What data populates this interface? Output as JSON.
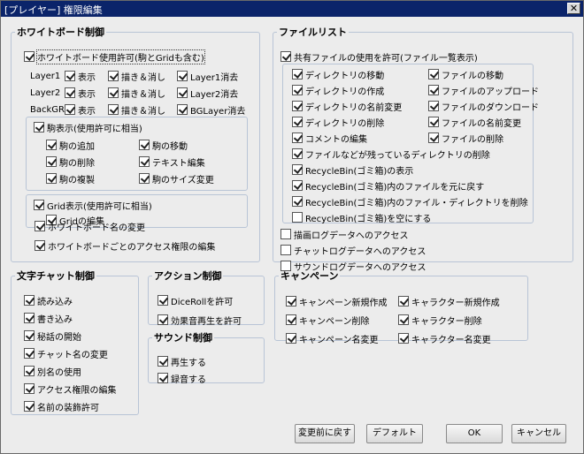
{
  "window": {
    "title": "[プレイヤー] 権限編集",
    "close_symbol": "✕"
  },
  "whiteboard": {
    "legend": "ホワイトボード制御",
    "allow": {
      "label": "ホワイトボード使用許可(駒とGridも含む)",
      "checked": true
    },
    "layers": [
      {
        "name": "Layer1",
        "show": "表示",
        "draw": "描き＆消し",
        "clear": "Layer1消去",
        "show_checked": true,
        "draw_checked": true,
        "clear_checked": true
      },
      {
        "name": "Layer2",
        "show": "表示",
        "draw": "描き＆消し",
        "clear": "Layer2消去",
        "show_checked": true,
        "draw_checked": true,
        "clear_checked": true
      },
      {
        "name": "BackGR",
        "show": "表示",
        "draw": "描き＆消し",
        "clear": "BGLayer消去",
        "show_checked": true,
        "draw_checked": true,
        "clear_checked": true
      }
    ],
    "piece_show": {
      "label": "駒表示(使用許可に相当)",
      "checked": true
    },
    "piece_items": [
      {
        "label": "駒の追加",
        "checked": true
      },
      {
        "label": "駒の移動",
        "checked": true
      },
      {
        "label": "駒の削除",
        "checked": true
      },
      {
        "label": "テキスト編集",
        "checked": true
      },
      {
        "label": "駒の複製",
        "checked": true
      },
      {
        "label": "駒のサイズ変更",
        "checked": true
      }
    ],
    "grid_show": {
      "label": "Grid表示(使用許可に相当)",
      "checked": true
    },
    "grid_edit": {
      "label": "Gridの編集",
      "checked": true
    },
    "rename": {
      "label": "ホワイトボード名の変更",
      "checked": true
    },
    "access_edit": {
      "label": "ホワイトボードごとのアクセス権限の編集",
      "checked": true
    }
  },
  "filelist": {
    "legend": "ファイルリスト",
    "allow": {
      "label": "共有ファイルの使用を許可(ファイル一覧表示)",
      "checked": true
    },
    "pairs": [
      [
        {
          "label": "ディレクトリの移動",
          "checked": true
        },
        {
          "label": "ファイルの移動",
          "checked": true
        }
      ],
      [
        {
          "label": "ディレクトリの作成",
          "checked": true
        },
        {
          "label": "ファイルのアップロード",
          "checked": true
        }
      ],
      [
        {
          "label": "ディレクトリの名前変更",
          "checked": true
        },
        {
          "label": "ファイルのダウンロード",
          "checked": true
        }
      ],
      [
        {
          "label": "ディレクトリの削除",
          "checked": true
        },
        {
          "label": "ファイルの名前変更",
          "checked": true
        }
      ],
      [
        {
          "label": "コメントの編集",
          "checked": true
        },
        {
          "label": "ファイルの削除",
          "checked": true
        }
      ]
    ],
    "singles": [
      {
        "label": "ファイルなどが残っているディレクトリの削除",
        "checked": true
      },
      {
        "label": "RecycleBin(ゴミ箱)の表示",
        "checked": true
      },
      {
        "label": "RecycleBin(ゴミ箱)内のファイルを元に戻す",
        "checked": true
      },
      {
        "label": "RecycleBin(ゴミ箱)内のファイル・ディレクトリを削除",
        "checked": true
      },
      {
        "label": "RecycleBin(ゴミ箱)を空にする",
        "checked": false
      }
    ],
    "logs": [
      {
        "label": "描画ログデータへのアクセス",
        "checked": false
      },
      {
        "label": "チャットログデータへのアクセス",
        "checked": false
      },
      {
        "label": "サウンドログデータへのアクセス",
        "checked": false
      }
    ]
  },
  "chat": {
    "legend": "文字チャット制御",
    "items": [
      {
        "label": "読み込み",
        "checked": true
      },
      {
        "label": "書き込み",
        "checked": true
      },
      {
        "label": "秘話の開始",
        "checked": true
      },
      {
        "label": "チャット名の変更",
        "checked": true
      },
      {
        "label": "別名の使用",
        "checked": true
      },
      {
        "label": "アクセス権限の編集",
        "checked": true
      },
      {
        "label": "名前の装飾許可",
        "checked": true
      }
    ]
  },
  "action": {
    "legend": "アクション制御",
    "items": [
      {
        "label": "DiceRollを許可",
        "checked": true
      },
      {
        "label": "効果音再生を許可",
        "checked": true
      }
    ]
  },
  "sound": {
    "legend": "サウンド制御",
    "items": [
      {
        "label": "再生する",
        "checked": true
      },
      {
        "label": "録音する",
        "checked": true
      }
    ]
  },
  "campaign": {
    "legend": "キャンペーン",
    "items": [
      {
        "label": "キャンペーン新規作成",
        "checked": true
      },
      {
        "label": "キャラクター新規作成",
        "checked": true
      },
      {
        "label": "キャンペーン削除",
        "checked": true
      },
      {
        "label": "キャラクター削除",
        "checked": true
      },
      {
        "label": "キャンペーン名変更",
        "checked": true
      },
      {
        "label": "キャラクター名変更",
        "checked": true
      }
    ]
  },
  "buttons": {
    "revert": "変更前に戻す",
    "default": "デフォルト",
    "ok": "OK",
    "cancel": "キャンセル"
  }
}
